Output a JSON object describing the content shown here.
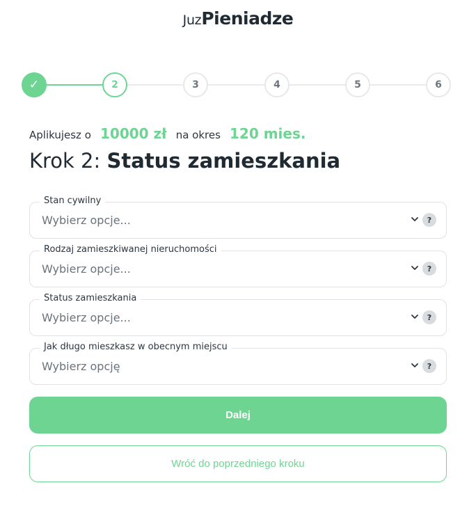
{
  "logo": {
    "light": "Juz",
    "bold": "Pieniadze"
  },
  "stepper": {
    "done_mark": "✓",
    "steps": [
      "1",
      "2",
      "3",
      "4",
      "5",
      "6"
    ],
    "current": 2,
    "accent": "#6dd591"
  },
  "application": {
    "prefix": "Aplikujesz o",
    "amount": "10000 zł",
    "middle": "na okres",
    "period": "120 mies."
  },
  "title": {
    "step": "Krok 2:",
    "name": "Status zamieszkania"
  },
  "fields": [
    {
      "label": "Stan cywilny",
      "value": "Wybierz opcje...",
      "help": "?"
    },
    {
      "label": "Rodzaj zamieszkiwanej nieruchomości",
      "value": "Wybierz opcje...",
      "help": "?"
    },
    {
      "label": "Status zamieszkania",
      "value": "Wybierz opcje...",
      "help": "?"
    },
    {
      "label": "Jak długo mieszkasz w obecnym miejscu",
      "value": "Wybierz opcję",
      "help": "?"
    }
  ],
  "buttons": {
    "next": "Dalej",
    "back": "Wróć do poprzedniego kroku"
  }
}
